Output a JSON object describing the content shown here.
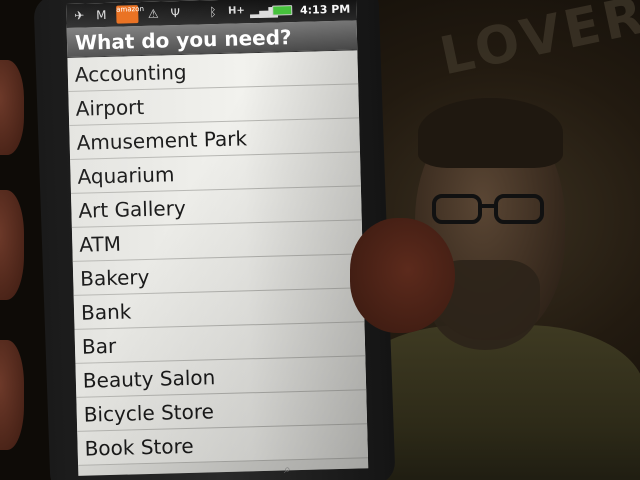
{
  "background": {
    "sign_text": "LOVER"
  },
  "status_bar": {
    "icons": [
      "bird-icon",
      "gmail-icon",
      "amazon-mp3-icon",
      "warning-icon",
      "usb-icon",
      "bluetooth-icon",
      "hplus-network-icon",
      "signal-icon",
      "battery-icon"
    ],
    "amazon_label": "amazon",
    "network_label": "H+",
    "time": "4:13 PM",
    "battery_color": "#46c23c"
  },
  "screen": {
    "title": "What do you need?",
    "items": [
      "Accounting",
      "Airport",
      "Amusement Park",
      "Aquarium",
      "Art Gallery",
      "ATM",
      "Bakery",
      "Bank",
      "Bar",
      "Beauty Salon",
      "Bicycle Store",
      "Book Store"
    ]
  }
}
